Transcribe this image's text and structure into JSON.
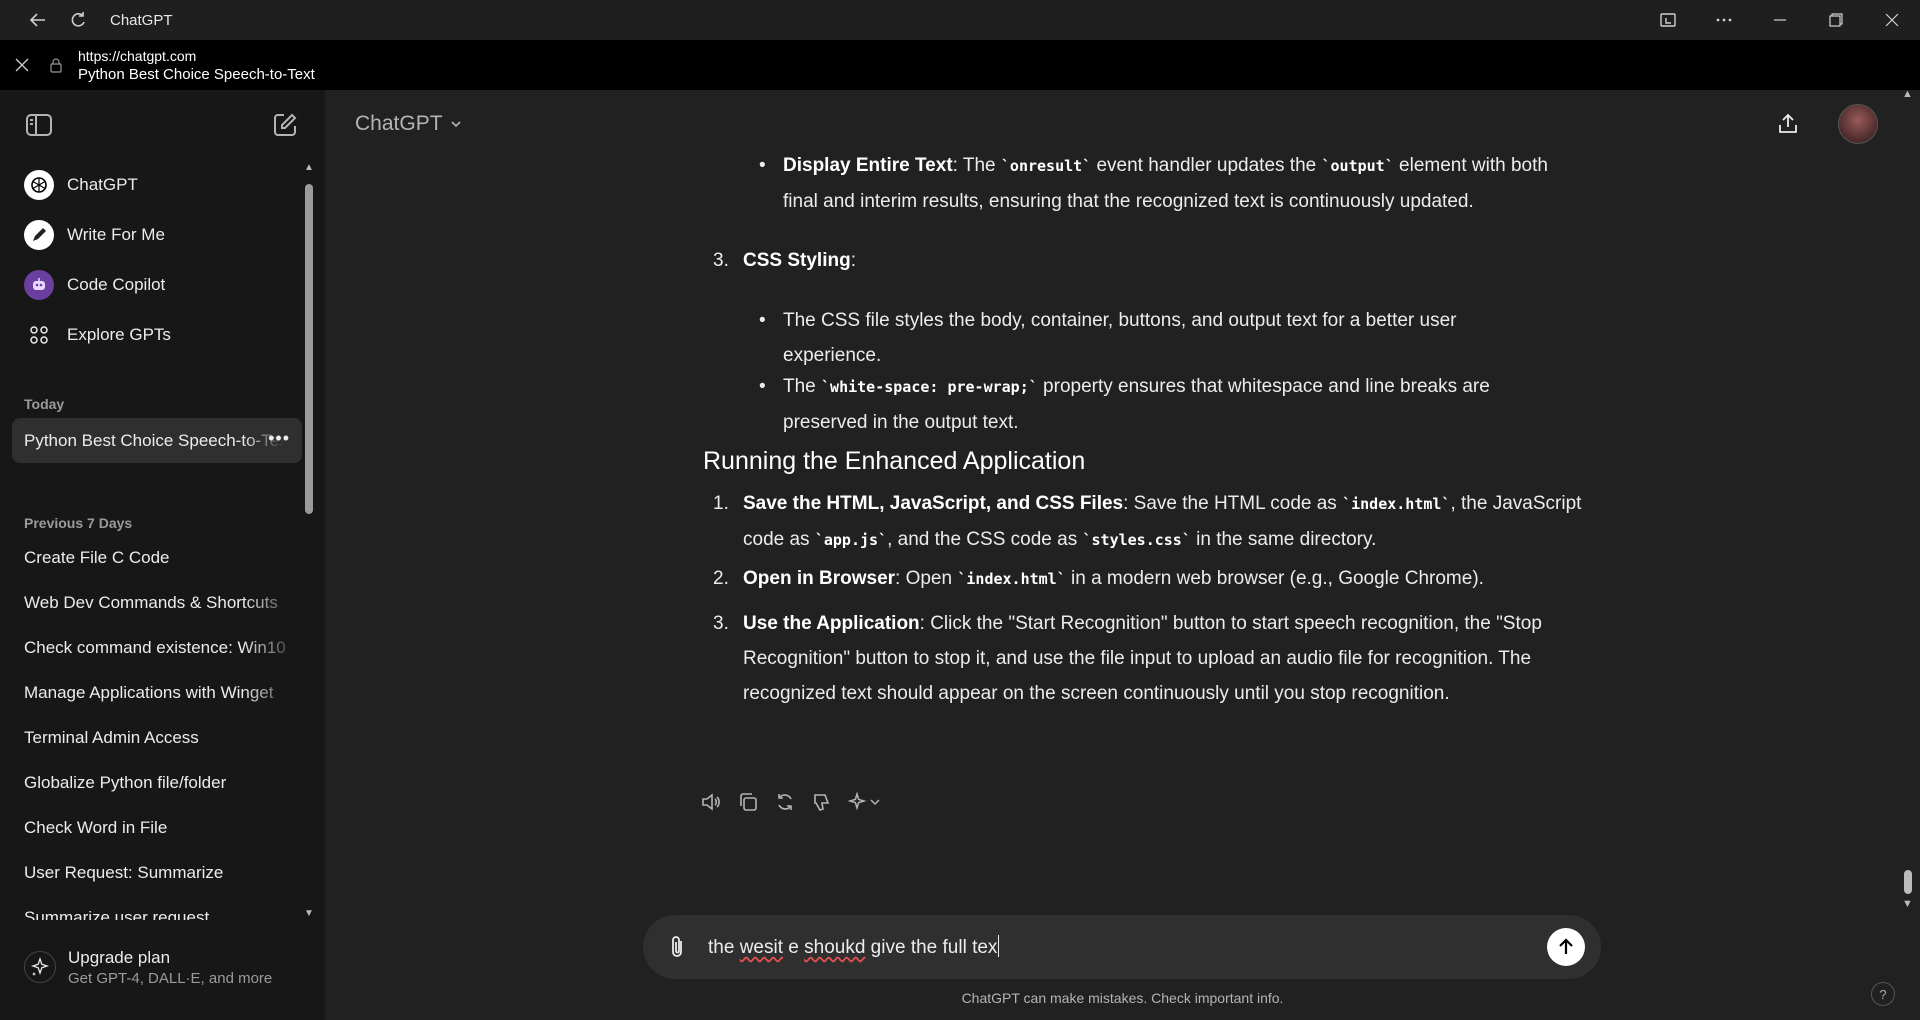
{
  "window": {
    "title": "ChatGPT",
    "url": "https://chatgpt.com",
    "page_title": "Python Best Choice Speech-to-Text"
  },
  "sidebar": {
    "gpts": [
      {
        "label": "ChatGPT",
        "icon": "chatgpt-logo-icon"
      },
      {
        "label": "Write For Me",
        "icon": "pen-icon"
      },
      {
        "label": "Code Copilot",
        "icon": "robot-icon"
      },
      {
        "label": "Explore GPTs",
        "icon": "grid-icon"
      }
    ],
    "today_label": "Today",
    "today_chats": [
      "Python Best Choice Speech-to-Text"
    ],
    "previous_label": "Previous 7 Days",
    "previous_chats": [
      "Create File C Code",
      "Web Dev Commands & Shortcuts",
      "Check command existence: Win10",
      "Manage Applications with Winget",
      "Terminal Admin Access",
      "Globalize Python file/folder",
      "Check Word in File",
      "User Request: Summarize",
      "Summarize user request"
    ],
    "upgrade_title": "Upgrade plan",
    "upgrade_sub": "Get GPT-4, DALL·E, and more"
  },
  "header": {
    "model": "ChatGPT"
  },
  "message": {
    "b1_label": "Display Entire Text",
    "b1_t1": ": The ",
    "b1_c1": "`onresult`",
    "b1_t2": " event handler updates the ",
    "b1_c2": "`output`",
    "b1_t3": " element with both",
    "b1_line2": "final and interim results, ensuring that the recognized text is continuously updated.",
    "n3_num": "3.",
    "n3_label": "CSS Styling",
    "n3_colon": ":",
    "b2_line1": "The CSS file styles the body, container, buttons, and output text for a better user",
    "b2_line2": "experience.",
    "b3_t1": "The ",
    "b3_c1": "`white-space: pre-wrap;`",
    "b3_t2": " property ensures that whitespace and line breaks are",
    "b3_line2": "preserved in the output text.",
    "heading": "Running the Enhanced Application",
    "s1_num": "1.",
    "s1_label": "Save the HTML, JavaScript, and CSS Files",
    "s1_t1": ": Save the HTML code as ",
    "s1_c1": "`index.html`",
    "s1_t2": ", the JavaScript",
    "s1_l2a": "code as ",
    "s1_c2": "`app.js`",
    "s1_l2b": ", and the CSS code as ",
    "s1_c3": "`styles.css`",
    "s1_l2c": " in the same directory.",
    "s2_num": "2.",
    "s2_label": "Open in Browser",
    "s2_t1": ": Open ",
    "s2_c1": "`index.html`",
    "s2_t2": " in a modern web browser (e.g., Google Chrome).",
    "s3_num": "3.",
    "s3_label": "Use the Application",
    "s3_t1": ": Click the \"Start Recognition\" button to start speech recognition, the \"Stop",
    "s3_line2": "Recognition\" button to stop it, and use the file input to upload an audio file for recognition. The",
    "s3_line3": "recognized text should appear on the screen continuously until you stop recognition."
  },
  "composer": {
    "text_a": "the ",
    "text_sp1": "wesit",
    "text_b": " e ",
    "text_sp2": "shoukd",
    "text_c": " give the full tex"
  },
  "footer": {
    "disclaimer": "ChatGPT can make mistakes. Check important info.",
    "help": "?"
  }
}
